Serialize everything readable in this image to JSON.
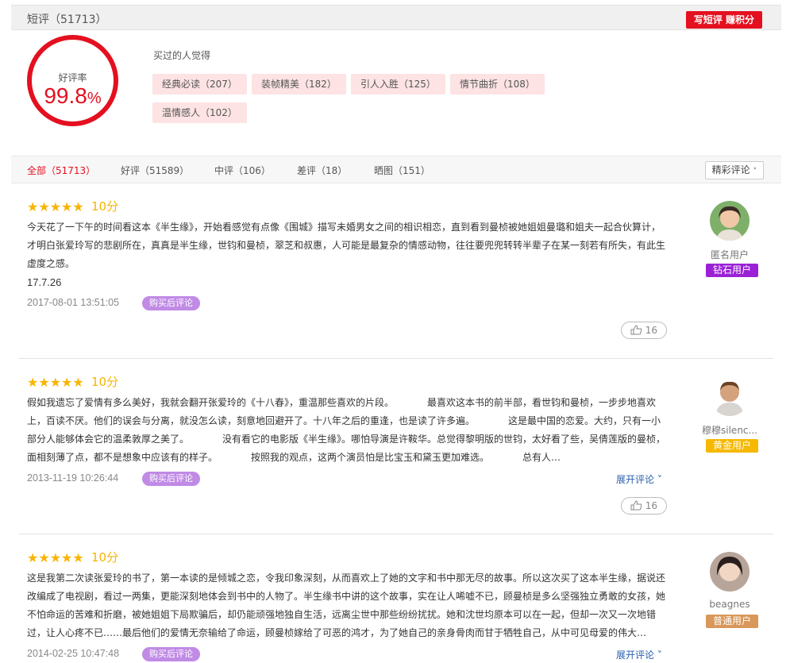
{
  "header": {
    "title": "短评（51713）",
    "write_button": "写短评 赚积分"
  },
  "rating": {
    "label": "好评率",
    "value": "99.8",
    "unit": "%"
  },
  "tags": {
    "title": "买过的人觉得",
    "items": [
      "经典必读（207）",
      "装帧精美（182）",
      "引人入胜（125）",
      "情节曲折（108）",
      "温情感人（102）"
    ]
  },
  "filters": {
    "tabs": [
      "全部（51713）",
      "好评（51589）",
      "中评（106）",
      "差评（18）",
      "晒图（151）"
    ],
    "sort": "精彩评论"
  },
  "reviews": [
    {
      "stars": "★★★★★",
      "score": "10分",
      "text": "今天花了一下午的时间看这本《半生缘》，开始看感觉有点像《围城》描写未婚男女之间的相识相恋，直到看到曼桢被她姐姐曼璐和姐夫一起合伙算计，才明白张爱玲写的悲剧所在，真真是半生缘，世钧和曼桢，翠芝和叔惠，人可能是最复杂的情感动物，往往要兜兜转转半辈子在某一刻若有所失，有此生虚度之感。",
      "extra": "17.7.26",
      "date": "2017-08-01 13:51:05",
      "badge": "购买后评论",
      "more": "",
      "likes": "16",
      "user": "匿名用户",
      "level": "钻石用户"
    },
    {
      "stars": "★★★★★",
      "score": "10分",
      "text": "假如我遗忘了爱情有多么美好，我就会翻开张爱玲的《十八春》，重温那些喜欢的片段。　　　　最喜欢这本书的前半部，看世钧和曼桢，一步步地喜欢上，百读不厌。他们的误会与分离，就没怎么读，刻意地回避开了。十八年之后的重逢，也是读了许多遍。　　　　这是最中国的恋爱。大约，只有一小部分人能够体会它的温柔敦厚之美了。　　　　没有看它的电影版《半生缘》。哪怕导演是许鞍华。总觉得黎明版的世钧，太好看了些，吴倩莲版的曼桢，面相刻薄了点，都不是想象中应该有的样子。　　　　按照我的观点，这两个演员怕是比宝玉和黛玉更加难选。　　　　总有人…",
      "extra": "",
      "date": "2013-11-19 10:26:44",
      "badge": "购买后评论",
      "more": "展开评论 ˅",
      "likes": "16",
      "user": "穆穆silenc...",
      "level": "黄金用户"
    },
    {
      "stars": "★★★★★",
      "score": "10分",
      "text": "这是我第二次读张爱玲的书了，第一本读的是倾城之恋，令我印象深刻，从而喜欢上了她的文字和书中那无尽的故事。所以这次买了这本半生缘，据说还改编成了电视剧，看过一两集，更能深刻地体会到书中的人物了。半生缘书中讲的这个故事，实在让人唏嘘不已，顾曼桢是多么坚强独立勇敢的女孩，她不怕命运的苦难和折磨，被她姐姐下局欺骗后，却仍能顽强地独自生活，远离尘世中那些纷纷扰扰。她和沈世均原本可以在一起，但却一次又一次地错过，让人心疼不已……最后他们的爱情无奈输给了命运，顾曼桢嫁给了可恶的鸿才，为了她自己的亲身骨肉而甘于牺牲自己，从中可见母爱的伟大…",
      "extra": "",
      "date": "2014-02-25 10:47:48",
      "badge": "购买后评论",
      "more": "展开评论 ˅",
      "likes": "",
      "user": "beagnes",
      "level": "普通用户"
    }
  ],
  "icons": {
    "like": "thumbs-up-icon",
    "chevron": "chevron-down-icon",
    "star": "star-icon"
  },
  "colors": {
    "accent": "#e4101f",
    "star": "#f8b400",
    "tag_bg": "#fde3e3",
    "badge": "#c08ae5",
    "diamond": "#9b21d6",
    "gold": "#f6b800",
    "normal": "#d9975a",
    "link": "#2a5fac"
  }
}
